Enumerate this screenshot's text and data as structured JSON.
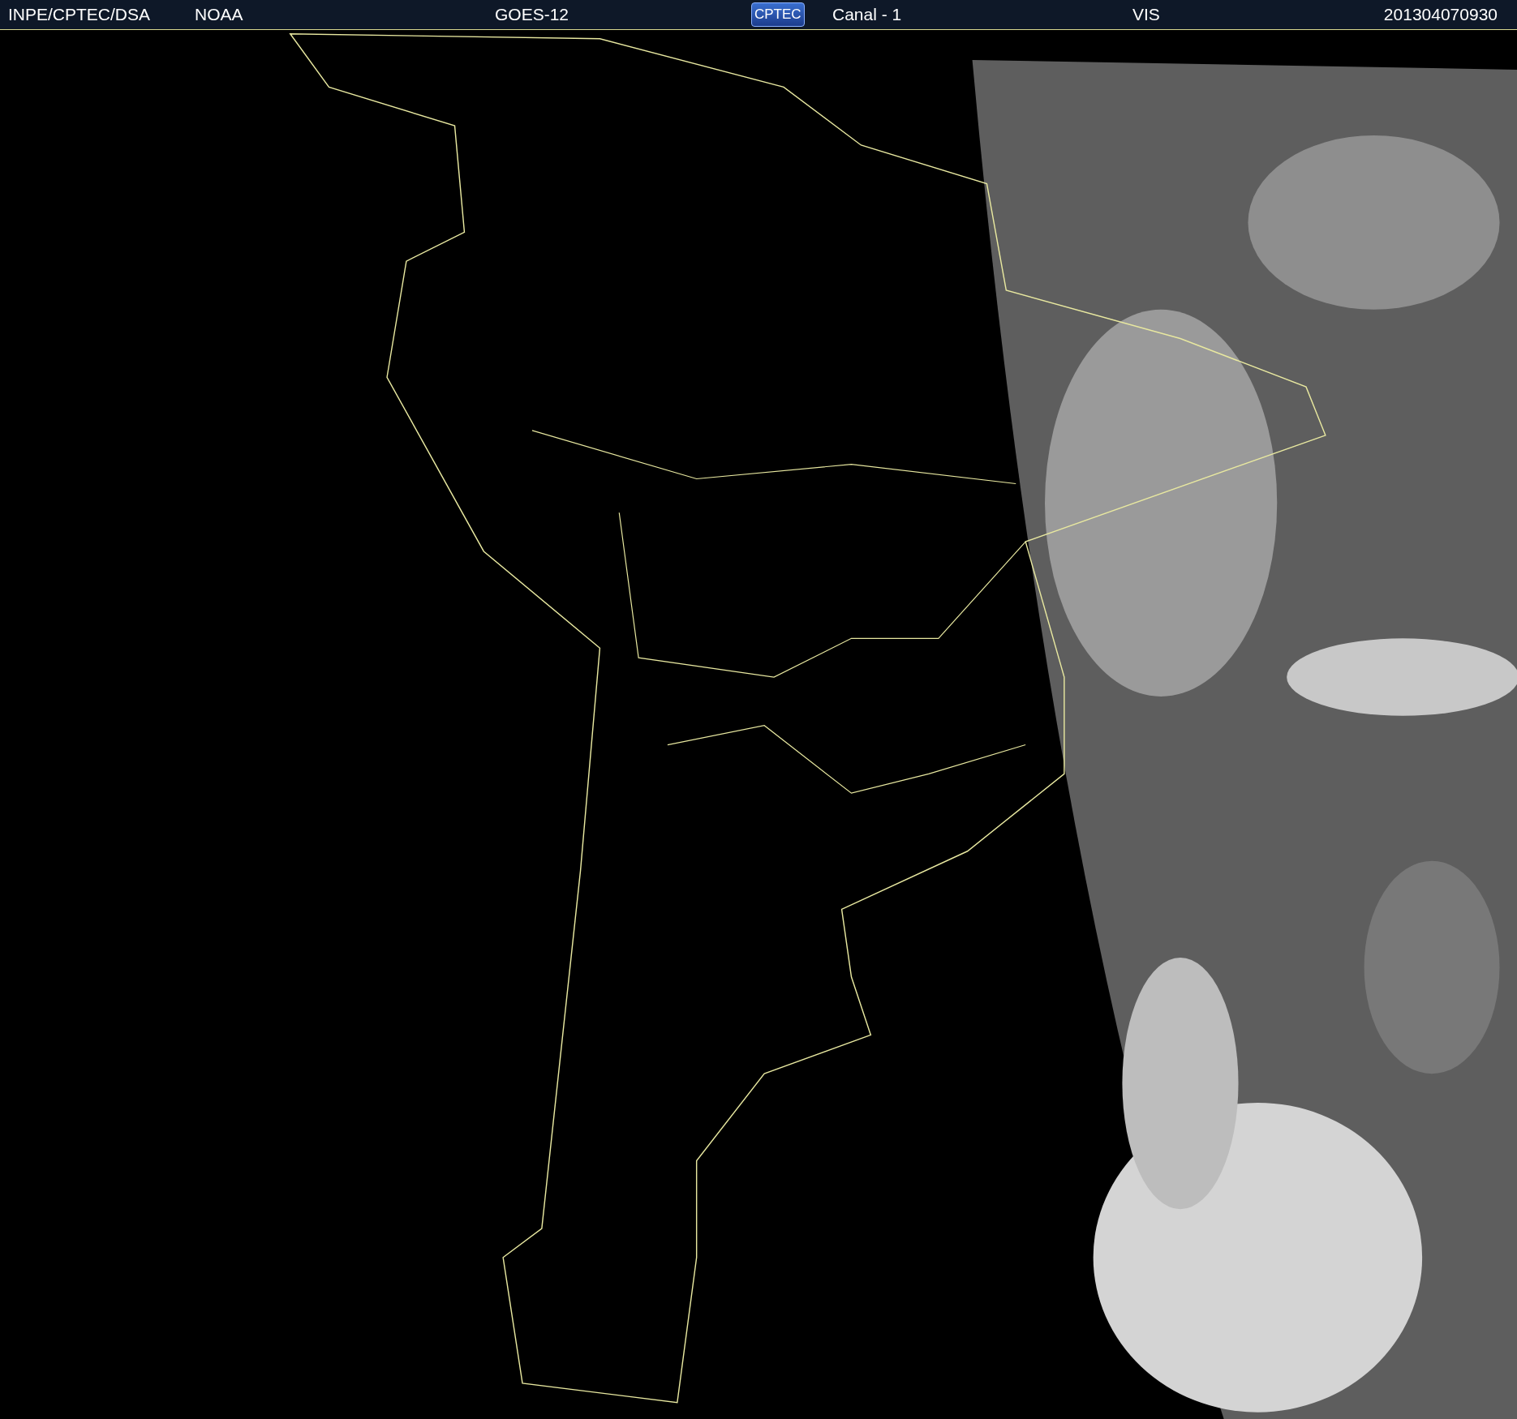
{
  "header": {
    "items": [
      {
        "kind": "text",
        "text": "INPE/CPTEC/DSA"
      },
      {
        "kind": "text",
        "text": "NOAA"
      },
      {
        "kind": "text",
        "text": "GOES-12"
      },
      {
        "kind": "logo",
        "text": "CPTEC"
      },
      {
        "kind": "text",
        "text": "Canal - 1"
      },
      {
        "kind": "text",
        "text": "VIS"
      },
      {
        "kind": "text",
        "text": "201304070930"
      }
    ]
  }
}
